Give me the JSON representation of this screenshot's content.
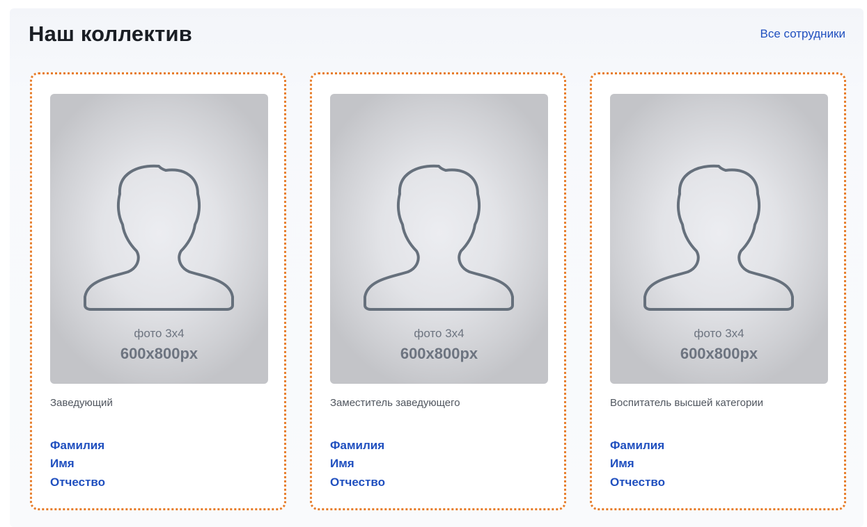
{
  "header": {
    "title": "Наш коллектив",
    "all_link": "Все сотрудники"
  },
  "colors": {
    "accent_link": "#1f4fbf",
    "card_border": "#e77d2a",
    "title": "#1a1e24"
  },
  "cards": [
    {
      "photo_caption": "фото 3х4",
      "photo_size": "600x800px",
      "role": "Заведующий",
      "surname": "Фамилия",
      "name": "Имя",
      "patronymic": "Отчество",
      "icon": "person-silhouette-icon"
    },
    {
      "photo_caption": "фото 3х4",
      "photo_size": "600x800px",
      "role": "Заместитель заведующего",
      "surname": "Фамилия",
      "name": "Имя",
      "patronymic": "Отчество",
      "icon": "person-silhouette-icon"
    },
    {
      "photo_caption": "фото 3х4",
      "photo_size": "600x800px",
      "role": "Воспитатель высшей категории",
      "surname": "Фамилия",
      "name": "Имя",
      "patronymic": "Отчество",
      "icon": "person-silhouette-icon"
    }
  ]
}
